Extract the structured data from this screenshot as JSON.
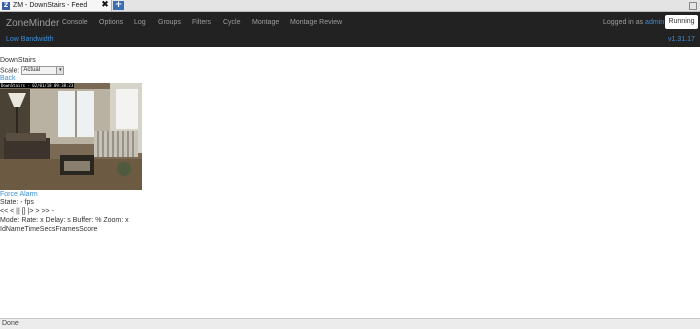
{
  "browser": {
    "tab_title": "ZM - DownStairs - Feed",
    "favicon_text": "Z",
    "close_glyph": "✖",
    "new_tab_glyph": "+",
    "status_text": "Done"
  },
  "navbar": {
    "brand": "ZoneMinder",
    "items": [
      "Console",
      "Options",
      "Log",
      "Groups",
      "Filters",
      "Cycle",
      "Montage",
      "Montage Review"
    ],
    "login_prefix": "Logged in as",
    "login_user": "admin",
    "state_button": "Running",
    "bandwidth": "Low Bandwidth",
    "version": "v1.31.17"
  },
  "content": {
    "monitor_name": "DownStairs",
    "scale_label": "Scale:",
    "scale_value": "Actual",
    "back_link": "Back",
    "camera_overlay": "DownStairs - 02/01/18 09:38:23",
    "force_alarm": "Force Alarm",
    "state_line": "State:  -   fps",
    "controls": "<< < || [] |> > >> -",
    "mode_line": "Mode: Rate: x Delay: s Buffer: % Zoom: x",
    "events_header": "IdNameTimeSecsFramesScore"
  },
  "colors": {
    "navbar_bg": "#222222",
    "link": "#3d8fd8",
    "nav_text": "#9d9d9d"
  },
  "icons": {
    "tab_close": "close-icon",
    "new_tab": "plus-icon",
    "scale_dropdown": "chevron-down-icon"
  }
}
